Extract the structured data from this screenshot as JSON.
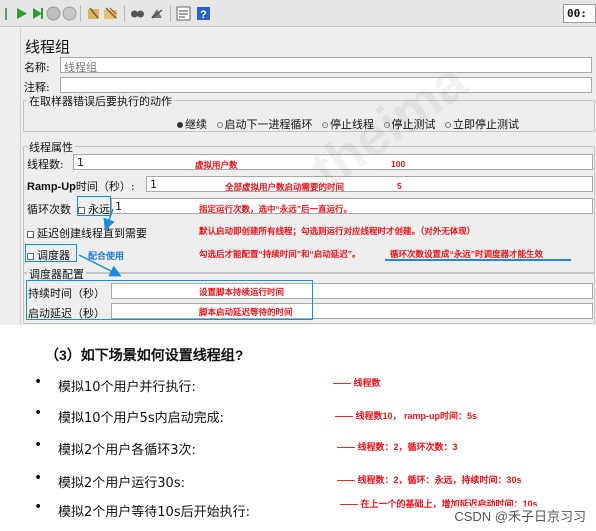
{
  "toolbar": {
    "icons": [
      "start-icon",
      "start-no-pauses-icon",
      "stop-icon",
      "shutdown-icon",
      "clear-icon",
      "clear-all-icon",
      "search-icon",
      "reset-search-icon",
      "function-helper-icon",
      "help-icon"
    ],
    "time": "00:"
  },
  "panel": {
    "title": "线程组",
    "name_label": "名称:",
    "name_value": "线程组",
    "comment_label": "注释:",
    "on_error_label": "在取样器错误后要执行的动作",
    "on_error_options": [
      "继续",
      "启动下一进程循环",
      "停止线程",
      "停止测试",
      "立即停止测试"
    ],
    "on_error_selected": "继续",
    "properties_label": "线程属性",
    "threads_label": "线程数:",
    "threads_value": "1",
    "rampup_label_a": "Ramp-Up",
    "rampup_label_b": "时间（秒）:",
    "rampup_value": "1",
    "loop_label": "循环次数",
    "forever_label": "永远",
    "loop_value": "1",
    "delay_label": "延迟创建线程直到需要",
    "scheduler_label": "调度器",
    "scheduler_config_label": "调度器配置",
    "duration_label": "持续时间（秒）",
    "startup_delay_label": "启动延迟（秒）"
  },
  "annotations": {
    "threads_note": "虚拟用户数",
    "threads_num": "100",
    "rampup_note": "全部虚拟用户数启动需要的时间",
    "rampup_num": "5",
    "loop_note": "指定运行次数，选中“永远”后一直运行。",
    "delay_note": "默认启动即创建所有线程；勾选则运行对应线程时才创建。（对外无体现）",
    "scheduler_note": "勾选后才能配置“持续时间”和“启动延迟”。",
    "scheduler_note_b": "循环次数设置成“永远”时调度器才能生效",
    "combined_use": "配合使用",
    "duration_note": "设置脚本持续运行时间",
    "startup_note": "脚本启动延迟等待的时间"
  },
  "scenario": {
    "heading": "（3）如下场景如何设置线程组?",
    "items": [
      {
        "text": "模拟10个用户并行执行:",
        "answer": "—— 线程数"
      },
      {
        "text": "模拟10个用户5s内启动完成:",
        "answer": "—— 线程数10， ramp-up时间：5s"
      },
      {
        "text": "模拟2个用户各循环3次:",
        "answer": "—— 线程数：2，循环次数：3"
      },
      {
        "text": "模拟2个用户运行30s:",
        "answer": "—— 线程数：2，循环：永远，持续时间：30s"
      },
      {
        "text": "模拟2个用户等待10s后开始执行:",
        "answer": "—— 在上一个的基础上，增加延迟启动时间：10s"
      }
    ]
  },
  "watermark": "theima",
  "credit": "CSDN @禾子日京习习",
  "colors": {
    "annotation_red": "#e8161b",
    "annotation_blue": "#1e7fd6",
    "panel_bg": "#eeeeee"
  }
}
